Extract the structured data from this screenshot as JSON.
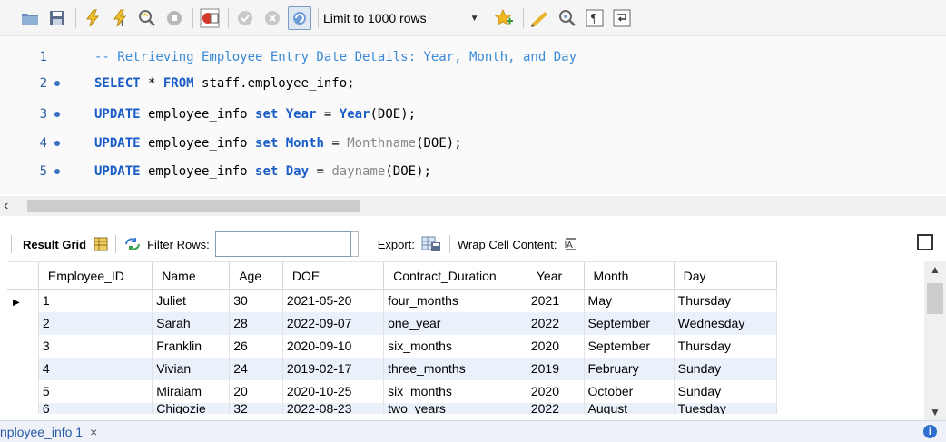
{
  "toolbar": {
    "limit_label": "Limit to 1000 rows",
    "icons": [
      "folder-icon",
      "save-icon",
      "execute-icon",
      "execute-statement-icon",
      "explain-icon",
      "stop-icon",
      "toggle-error-icon",
      "commit-icon",
      "rollback-icon",
      "autocommit-icon",
      "bookmark-icon",
      "beautify-icon",
      "find-icon",
      "invisible-chars-icon",
      "wrap-icon"
    ]
  },
  "editor": {
    "lines": [
      {
        "num": "1",
        "segments": [
          {
            "t": "comment",
            "v": "-- Retrieving Employee Entry Date Details: Year, Month, and Day"
          }
        ]
      },
      {
        "num": "2",
        "segments": [
          {
            "t": "kw",
            "v": "SELECT"
          },
          {
            "t": "plain",
            "v": " * "
          },
          {
            "t": "kw",
            "v": "FROM"
          },
          {
            "t": "plain",
            "v": " staff.employee_info;"
          }
        ]
      },
      {
        "num": "3",
        "segments": [
          {
            "t": "kw",
            "v": "UPDATE"
          },
          {
            "t": "plain",
            "v": " employee_info "
          },
          {
            "t": "kw",
            "v": "set"
          },
          {
            "t": "plain",
            "v": " "
          },
          {
            "t": "kw",
            "v": "Year"
          },
          {
            "t": "plain",
            "v": " = "
          },
          {
            "t": "fn",
            "v": "Year"
          },
          {
            "t": "plain",
            "v": "(DOE);"
          }
        ]
      },
      {
        "num": "4",
        "segments": [
          {
            "t": "kw",
            "v": "UPDATE"
          },
          {
            "t": "plain",
            "v": " employee_info "
          },
          {
            "t": "kw",
            "v": "set"
          },
          {
            "t": "plain",
            "v": " "
          },
          {
            "t": "kw",
            "v": "Month"
          },
          {
            "t": "plain",
            "v": " = "
          },
          {
            "t": "fn2",
            "v": "Monthname"
          },
          {
            "t": "plain",
            "v": "(DOE);"
          }
        ]
      },
      {
        "num": "5",
        "segments": [
          {
            "t": "kw",
            "v": "UPDATE"
          },
          {
            "t": "plain",
            "v": " employee_info "
          },
          {
            "t": "kw",
            "v": "set"
          },
          {
            "t": "plain",
            "v": " "
          },
          {
            "t": "kw",
            "v": "Day"
          },
          {
            "t": "plain",
            "v": " = "
          },
          {
            "t": "fn2",
            "v": "dayname"
          },
          {
            "t": "plain",
            "v": "(DOE);"
          }
        ]
      }
    ]
  },
  "results_toolbar": {
    "result_grid_label": "Result Grid",
    "filter_label": "Filter Rows:",
    "filter_value": "",
    "export_label": "Export:",
    "wrap_label": "Wrap Cell Content:"
  },
  "grid": {
    "columns": [
      "Employee_ID",
      "Name",
      "Age",
      "DOE",
      "Contract_Duration",
      "Year",
      "Month",
      "Day"
    ],
    "rows": [
      [
        "1",
        "Juliet",
        "30",
        "2021-05-20",
        "four_months",
        "2021",
        "May",
        "Thursday"
      ],
      [
        "2",
        "Sarah",
        "28",
        "2022-09-07",
        "one_year",
        "2022",
        "September",
        "Wednesday"
      ],
      [
        "3",
        "Franklin",
        "26",
        "2020-09-10",
        "six_months",
        "2020",
        "September",
        "Thursday"
      ],
      [
        "4",
        "Vivian",
        "24",
        "2019-02-17",
        "three_months",
        "2019",
        "February",
        "Sunday"
      ],
      [
        "5",
        "Miraiam",
        "20",
        "2020-10-25",
        "six_months",
        "2020",
        "October",
        "Sunday"
      ],
      [
        "6",
        "Chigozie",
        "32",
        "2022-08-23",
        "two_years",
        "2022",
        "August",
        "Tuesday"
      ]
    ],
    "current_row_marker": "▶"
  },
  "tabbar": {
    "tab_label": "nployee_info 1",
    "close_glyph": "×",
    "info_glyph": "i"
  },
  "colors": {
    "keyword": "#1a5dc8",
    "comment": "#3a8ad6",
    "alt_row": "#eaf1fb",
    "line_number": "#2b5fa6"
  }
}
